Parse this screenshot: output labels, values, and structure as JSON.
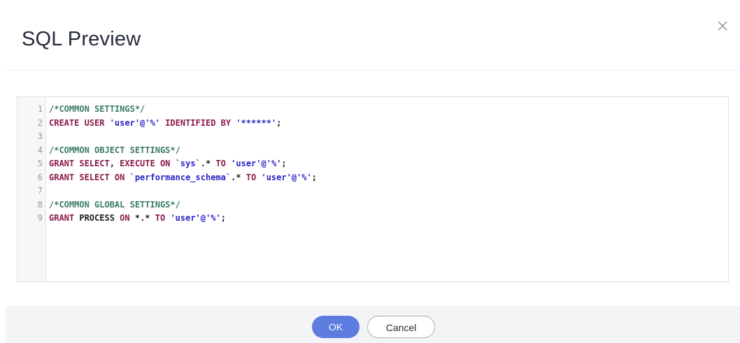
{
  "dialog": {
    "title": "SQL Preview",
    "close_icon": "close-icon",
    "ok_label": "OK",
    "cancel_label": "Cancel"
  },
  "colors": {
    "comment": "#3a7a6a",
    "keyword": "#8b1a4a",
    "string": "#2a24c8",
    "primary_button": "#5e7ce0"
  },
  "editor": {
    "lines": [
      {
        "num": "1",
        "tokens": [
          {
            "t": "cm",
            "v": "/*COMMON SETTINGS*/"
          }
        ]
      },
      {
        "num": "2",
        "tokens": [
          {
            "t": "kw",
            "v": "CREATE USER "
          },
          {
            "t": "str",
            "v": "'user'@'%'"
          },
          {
            "t": "kw",
            "v": " IDENTIFIED BY "
          },
          {
            "t": "str",
            "v": "'******'"
          },
          {
            "t": "pl",
            "v": ";"
          }
        ]
      },
      {
        "num": "3",
        "tokens": []
      },
      {
        "num": "4",
        "tokens": [
          {
            "t": "cm",
            "v": "/*COMMON OBJECT SETTINGS*/"
          }
        ]
      },
      {
        "num": "5",
        "tokens": [
          {
            "t": "kw",
            "v": "GRANT SELECT"
          },
          {
            "t": "pl",
            "v": ", "
          },
          {
            "t": "kw",
            "v": "EXECUTE ON "
          },
          {
            "t": "str",
            "v": "`sys`"
          },
          {
            "t": "pl",
            "v": ".* "
          },
          {
            "t": "kw",
            "v": "TO "
          },
          {
            "t": "str",
            "v": "'user'@'%'"
          },
          {
            "t": "pl",
            "v": ";"
          }
        ]
      },
      {
        "num": "6",
        "tokens": [
          {
            "t": "kw",
            "v": "GRANT SELECT ON "
          },
          {
            "t": "str",
            "v": "`performance_schema`"
          },
          {
            "t": "pl",
            "v": ".* "
          },
          {
            "t": "kw",
            "v": "TO "
          },
          {
            "t": "str",
            "v": "'user'@'%'"
          },
          {
            "t": "pl",
            "v": ";"
          }
        ]
      },
      {
        "num": "7",
        "tokens": []
      },
      {
        "num": "8",
        "tokens": [
          {
            "t": "cm",
            "v": "/*COMMON GLOBAL SETTINGS*/"
          }
        ]
      },
      {
        "num": "9",
        "tokens": [
          {
            "t": "kw",
            "v": "GRANT "
          },
          {
            "t": "pl",
            "v": "PROCESS "
          },
          {
            "t": "kw",
            "v": "ON "
          },
          {
            "t": "pl",
            "v": "*.* "
          },
          {
            "t": "kw",
            "v": "TO "
          },
          {
            "t": "str",
            "v": "'user'@'%'"
          },
          {
            "t": "pl",
            "v": ";"
          }
        ]
      }
    ]
  }
}
